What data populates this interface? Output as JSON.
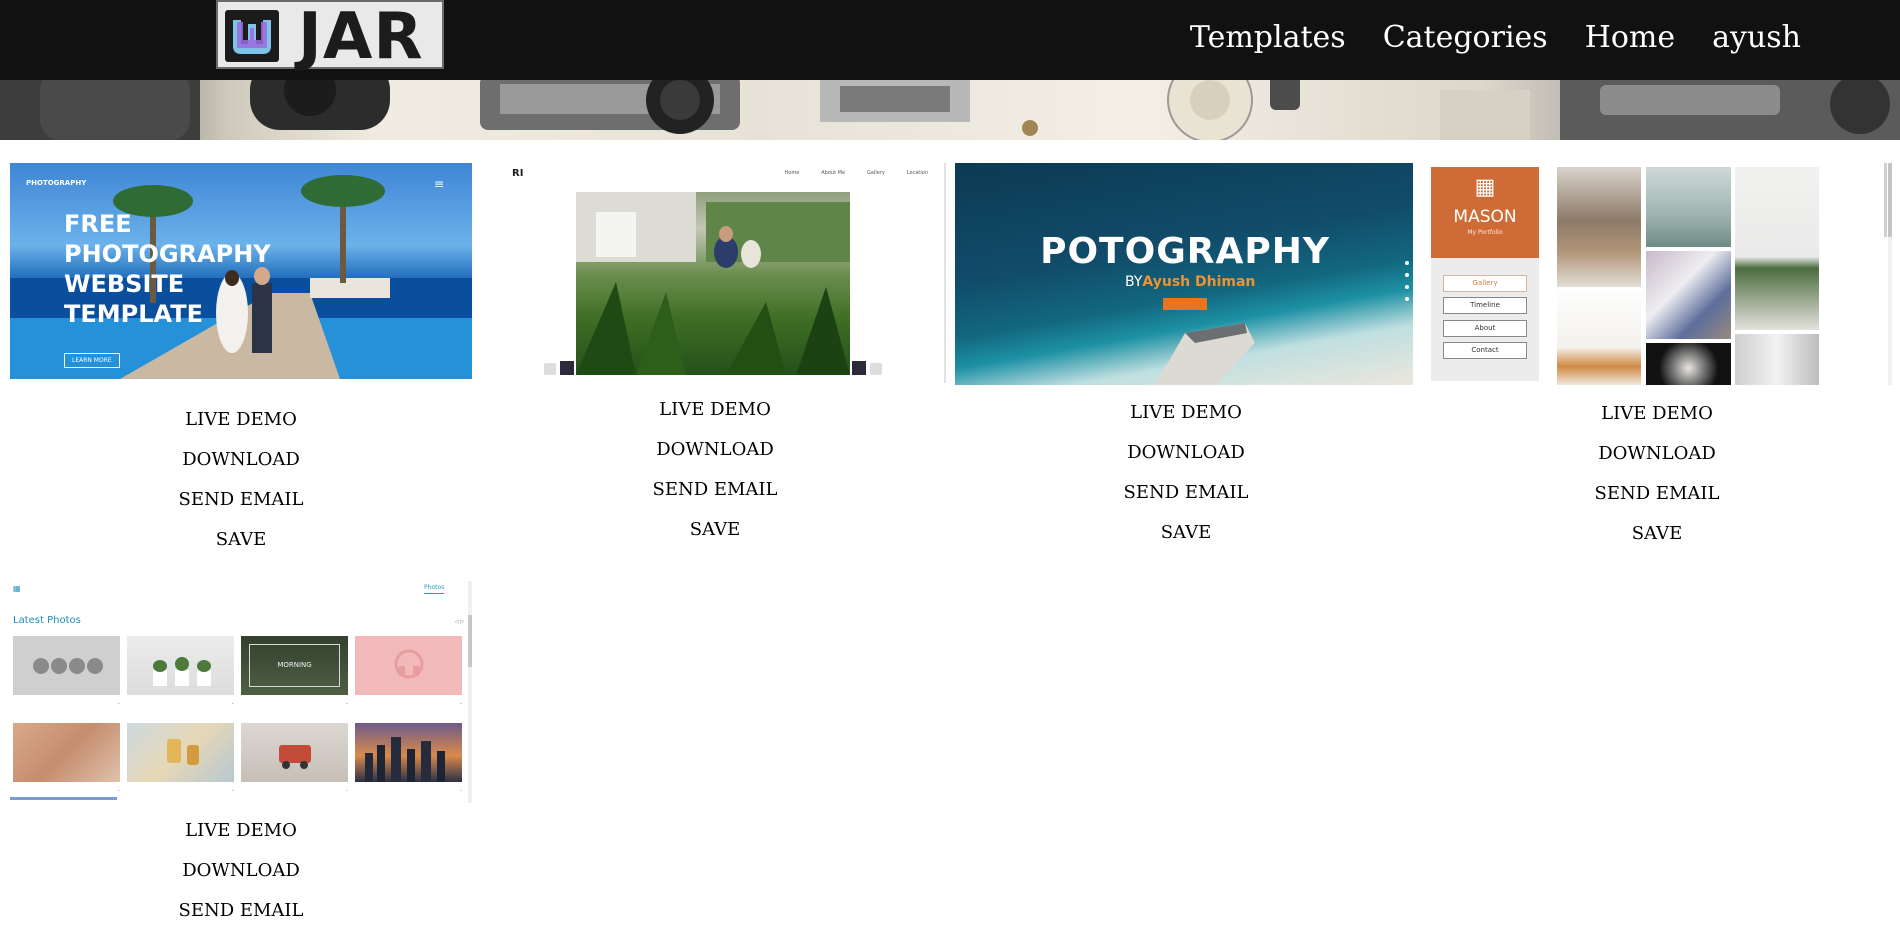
{
  "app": {
    "brand": "JAR",
    "colors": {
      "nav_bg": "#111111",
      "nav_text": "#ffffff",
      "accent_orange": "#cf6b37",
      "accent_blue": "#1e8db7"
    }
  },
  "nav": {
    "links": [
      {
        "label": "Templates"
      },
      {
        "label": "Categories"
      },
      {
        "label": "Home"
      },
      {
        "label": "ayush"
      }
    ]
  },
  "hero": {
    "image": "camera-gear-banner"
  },
  "actions": {
    "live_demo": "LIVE DEMO",
    "download": "DOWNLOAD",
    "send_email": "SEND EMAIL",
    "save": "SAVE"
  },
  "templates": [
    {
      "brand": "PHOTOGRAPHY",
      "title": "FREE PHOTOGRAPHY WEBSITE TEMPLATE",
      "button": "LEARN MORE"
    },
    {
      "logo": "RI",
      "nav": [
        "Home",
        "About Me",
        "Gallery",
        "Location"
      ]
    },
    {
      "title": "POTOGRAPHY",
      "by": "BY",
      "author": "Ayush Dhiman"
    },
    {
      "title": "MASON",
      "subtitle": "My Portfolio",
      "menu": [
        "Gallery",
        "Timeline",
        "About",
        "Contact"
      ]
    },
    {
      "tab": "Photos",
      "heading": "Latest Photos",
      "photo_caption": "MORNING"
    }
  ]
}
